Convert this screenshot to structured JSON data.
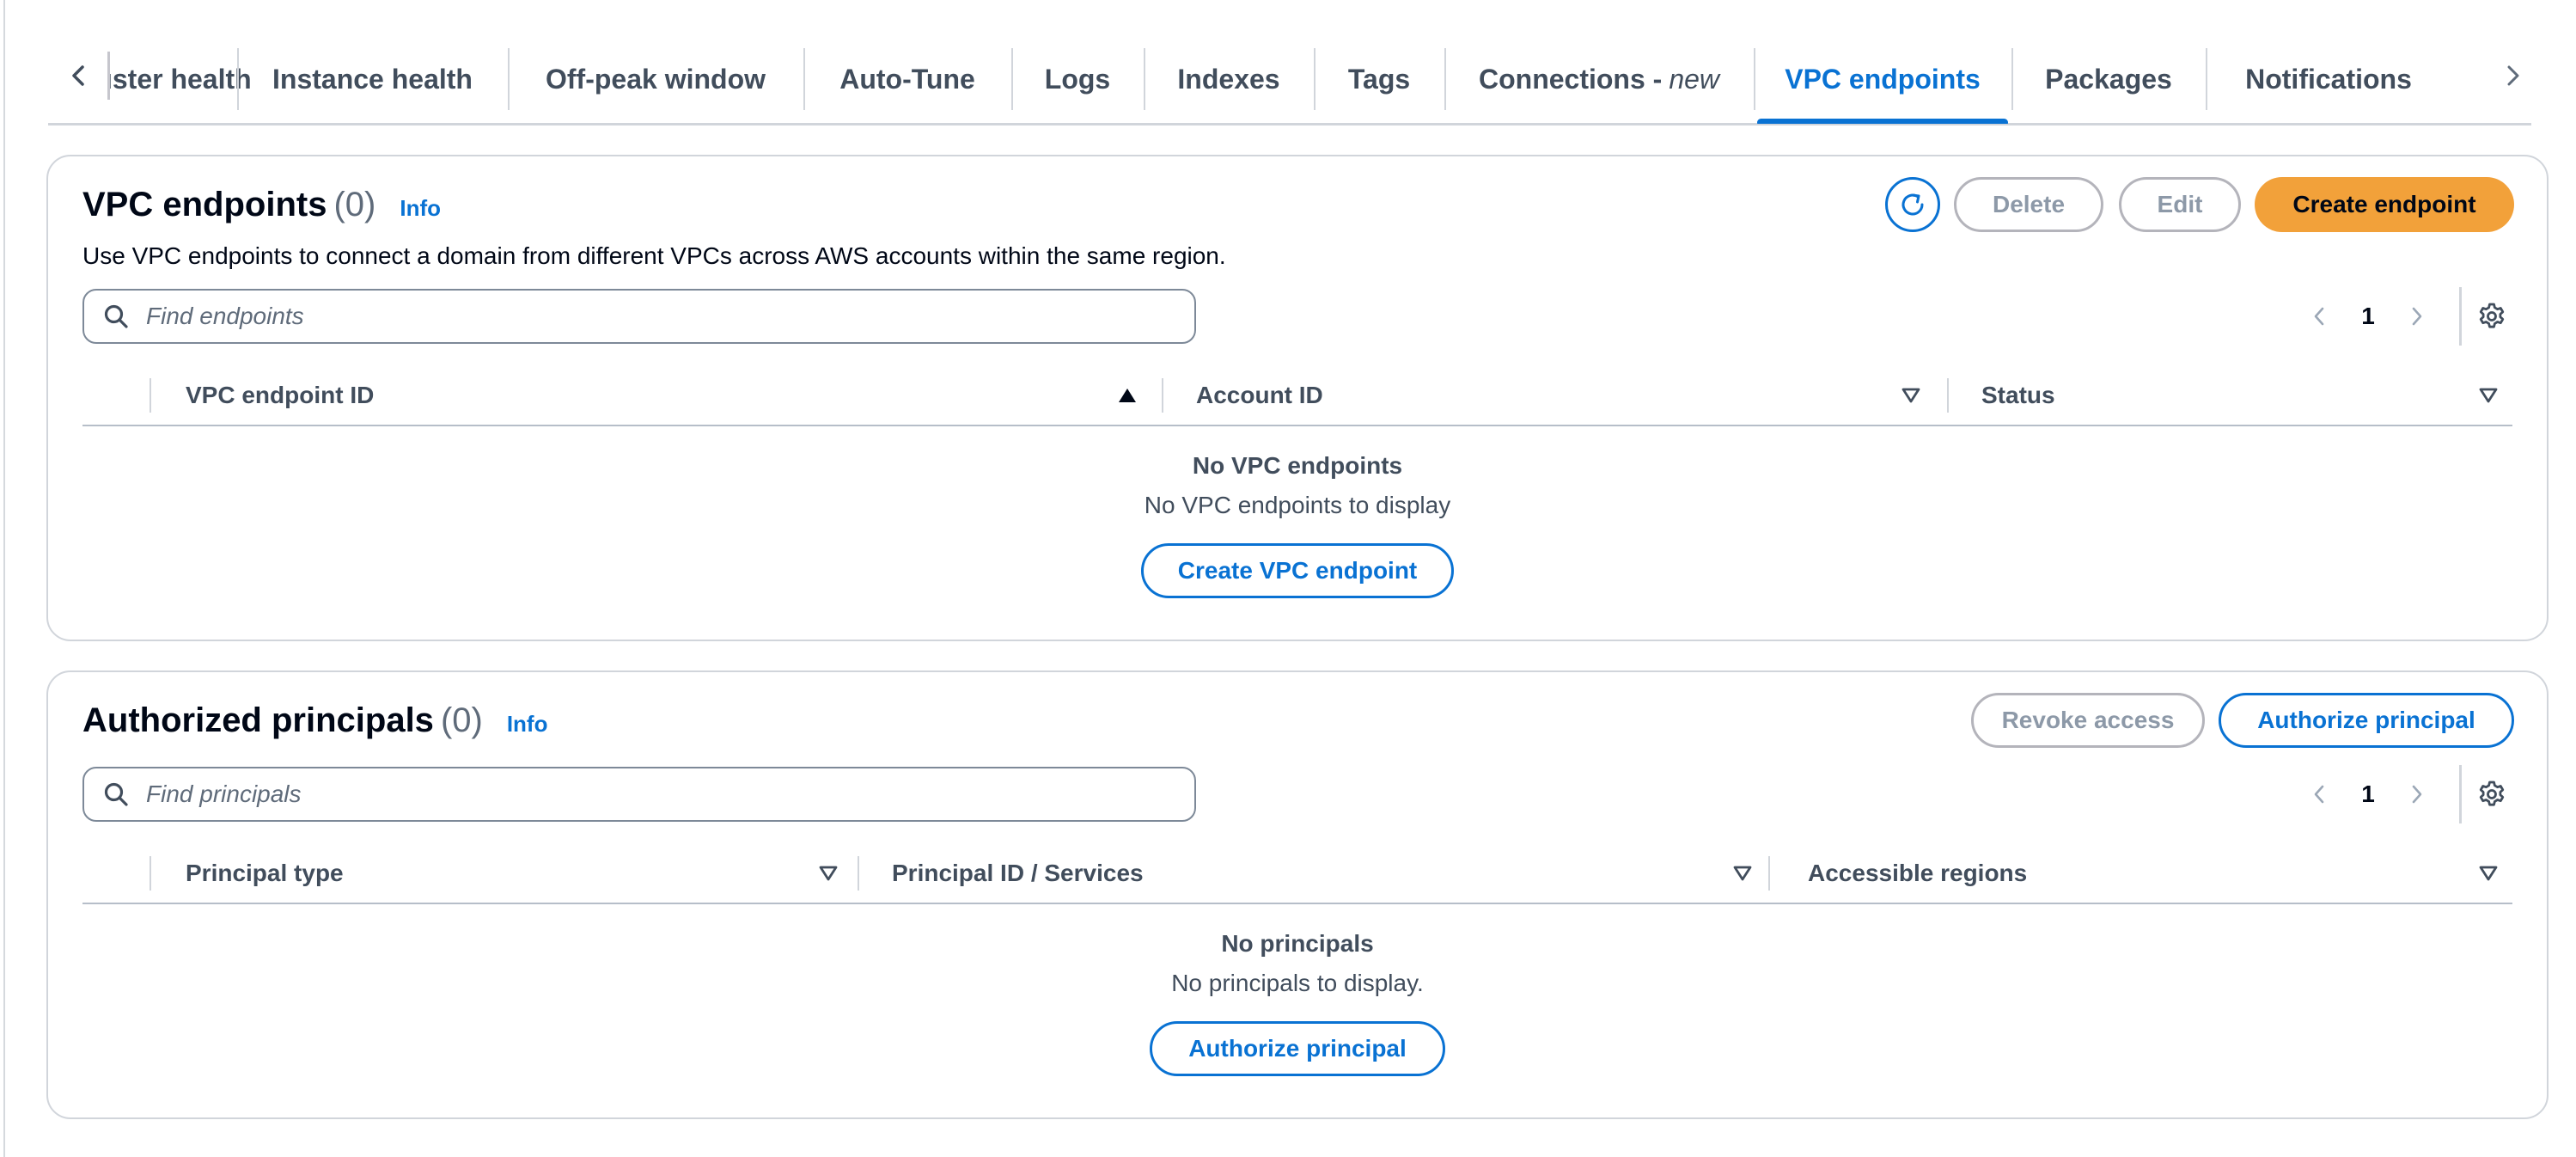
{
  "tabs": {
    "items": [
      {
        "label": "Cluster health",
        "suffix": ""
      },
      {
        "label": "Instance health",
        "suffix": ""
      },
      {
        "label": "Off-peak window",
        "suffix": ""
      },
      {
        "label": "Auto-Tune",
        "suffix": ""
      },
      {
        "label": "Logs",
        "suffix": ""
      },
      {
        "label": "Indexes",
        "suffix": ""
      },
      {
        "label": "Tags",
        "suffix": ""
      },
      {
        "label": "Connections - ",
        "suffix": "new"
      },
      {
        "label": "VPC endpoints",
        "suffix": ""
      },
      {
        "label": "Packages",
        "suffix": ""
      },
      {
        "label": "Notifications",
        "suffix": ""
      }
    ],
    "active": "VPC endpoints"
  },
  "vpc": {
    "title": "VPC endpoints",
    "count": "(0)",
    "info": "Info",
    "description": "Use VPC endpoints to connect a domain from different VPCs across AWS accounts within the same region.",
    "delete_label": "Delete",
    "edit_label": "Edit",
    "create_label": "Create endpoint",
    "search_placeholder": "Find endpoints",
    "page": "1",
    "columns": [
      "VPC endpoint ID",
      "Account ID",
      "Status"
    ],
    "empty_title": "No VPC endpoints",
    "empty_sub": "No VPC endpoints to display",
    "empty_button": "Create VPC endpoint"
  },
  "principals": {
    "title": "Authorized principals",
    "count": "(0)",
    "info": "Info",
    "revoke_label": "Revoke access",
    "authorize_label": "Authorize principal",
    "search_placeholder": "Find principals",
    "page": "1",
    "columns": [
      "Principal type",
      "Principal ID / Services",
      "Accessible regions"
    ],
    "empty_title": "No principals",
    "empty_sub": "No principals to display.",
    "empty_button": "Authorize principal"
  },
  "colors": {
    "accent": "#0972d3",
    "primary_button": "#f2a13a",
    "disabled": "#8d99a8"
  },
  "icons": {
    "tab_prev": "chevron-left-icon",
    "tab_next": "chevron-right-icon",
    "refresh": "refresh-icon",
    "search": "search-icon",
    "settings": "gear-icon",
    "sort_asc": "caret-up-filled-icon",
    "sort_none": "caret-down-outline-icon"
  }
}
